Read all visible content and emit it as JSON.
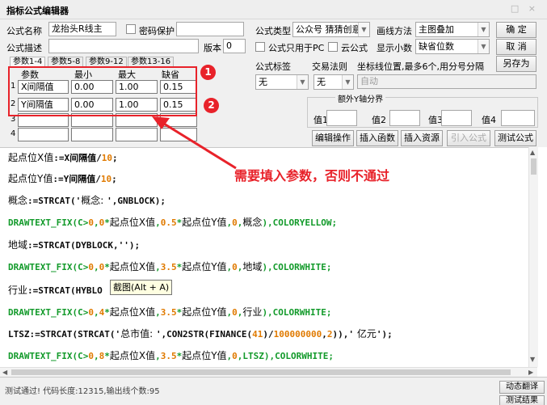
{
  "window": {
    "title": "指标公式编辑器",
    "controls": "□ ×"
  },
  "form": {
    "formula_name_label": "公式名称",
    "formula_name_value": "龙抬头R线主",
    "password_label": "密码保护",
    "formula_desc_label": "公式描述",
    "version_label": "版本",
    "version_value": "0",
    "formula_type_label": "公式类型",
    "formula_type_value": "公众号 猜猜创意",
    "draw_method_label": "画线方法",
    "draw_method_value": "主图叠加",
    "pc_only_label": "公式只用于PC",
    "cloud_label": "云公式",
    "decimals_label": "显示小数",
    "decimals_value": "缺省位数",
    "formula_tag_label": "公式标签",
    "formula_tag_value": "无",
    "trade_rule_label": "交易法则",
    "trade_rule_value": "无",
    "axis_hint": "坐标线位置,最多6个,用分号分隔",
    "axis_value": "自动",
    "extra_axis_label": "额外Y轴分界",
    "value1_label": "值1",
    "value2_label": "值2",
    "value3_label": "值3",
    "value4_label": "值4"
  },
  "buttons": {
    "ok": "确  定",
    "cancel": "取  消",
    "save_as": "另存为",
    "edit_ops": "编辑操作",
    "insert_func": "插入函数",
    "insert_res": "插入资源",
    "import_formula": "引入公式",
    "test_formula": "测试公式",
    "dynamic_translate": "动态翻译",
    "test_result": "测试结果"
  },
  "tabs": [
    "参数1-4",
    "参数5-8",
    "参数9-12",
    "参数13-16"
  ],
  "params": {
    "headers": [
      "参数",
      "最小",
      "最大",
      "缺省"
    ],
    "rows": [
      {
        "num": "1",
        "name": "X间隔值",
        "min": "0.00",
        "max": "1.00",
        "default": "0.15"
      },
      {
        "num": "2",
        "name": "Y间隔值",
        "min": "0.00",
        "max": "1.00",
        "default": "0.15"
      },
      {
        "num": "3",
        "name": "",
        "min": "",
        "max": "",
        "default": ""
      },
      {
        "num": "4",
        "name": "",
        "min": "",
        "max": "",
        "default": ""
      }
    ]
  },
  "annotation": {
    "badge1": "1",
    "badge2": "2",
    "text": "需要填入参数，否则不通过"
  },
  "tooltip": "截图(Alt + A)",
  "code": {
    "l1": [
      "起点位X值",
      ":=X间隔值/",
      "10",
      ";"
    ],
    "l2": [
      "起点位Y值",
      ":=Y间隔值/",
      "10",
      ";"
    ],
    "l3": [
      "概念",
      ":=STRCAT('",
      "概念: ",
      "',GNBLOCK);"
    ],
    "l4": [
      "DRAWTEXT_FIX(C>",
      "0",
      ",",
      "0",
      "*",
      "起点位X值",
      ",",
      "0.5",
      "*",
      "起点位Y值",
      ",",
      "0",
      ",",
      "概念",
      "),COLORYELLOW;"
    ],
    "l5": [
      "地域",
      ":=STRCAT(DYBLOCK,'');"
    ],
    "l6": [
      "DRAWTEXT_FIX(C>",
      "0",
      ",",
      "0",
      "*",
      "起点位X值",
      ",",
      "3.5",
      "*",
      "起点位Y值",
      ",",
      "0",
      ",",
      "地域",
      "),COLORWHITE;"
    ],
    "l7": [
      "行业",
      ":=STRCAT(HYBLO"
    ],
    "l8": [
      "DRAWTEXT_FIX(C>",
      "0",
      ",",
      "4",
      "*",
      "起点位X值",
      ",",
      "3.5",
      "*",
      "起点位Y值",
      ",",
      "0",
      ",",
      "行业",
      "),COLORWHITE;"
    ],
    "l9": [
      "LTSZ:=STRCAT(STRCAT('",
      "总市值: ",
      "',CON2STR(FINANCE(",
      "41",
      ")/",
      "100000000",
      ",",
      "2",
      ")),'",
      " 亿元",
      "');"
    ],
    "l10": [
      "DRAWTEXT_FIX(C>",
      "0",
      ",",
      "8",
      "*",
      "起点位X值",
      ",",
      "3.5",
      "*",
      "起点位Y值",
      ",",
      "0",
      ",LTSZ),COLORWHITE;"
    ]
  },
  "status_text": "测试通过! 代码长度:12315,输出线个数:95",
  "colors": {
    "code_green": "#129a2a",
    "code_orange": "#e07a00",
    "annotation_red": "#e8222a"
  }
}
